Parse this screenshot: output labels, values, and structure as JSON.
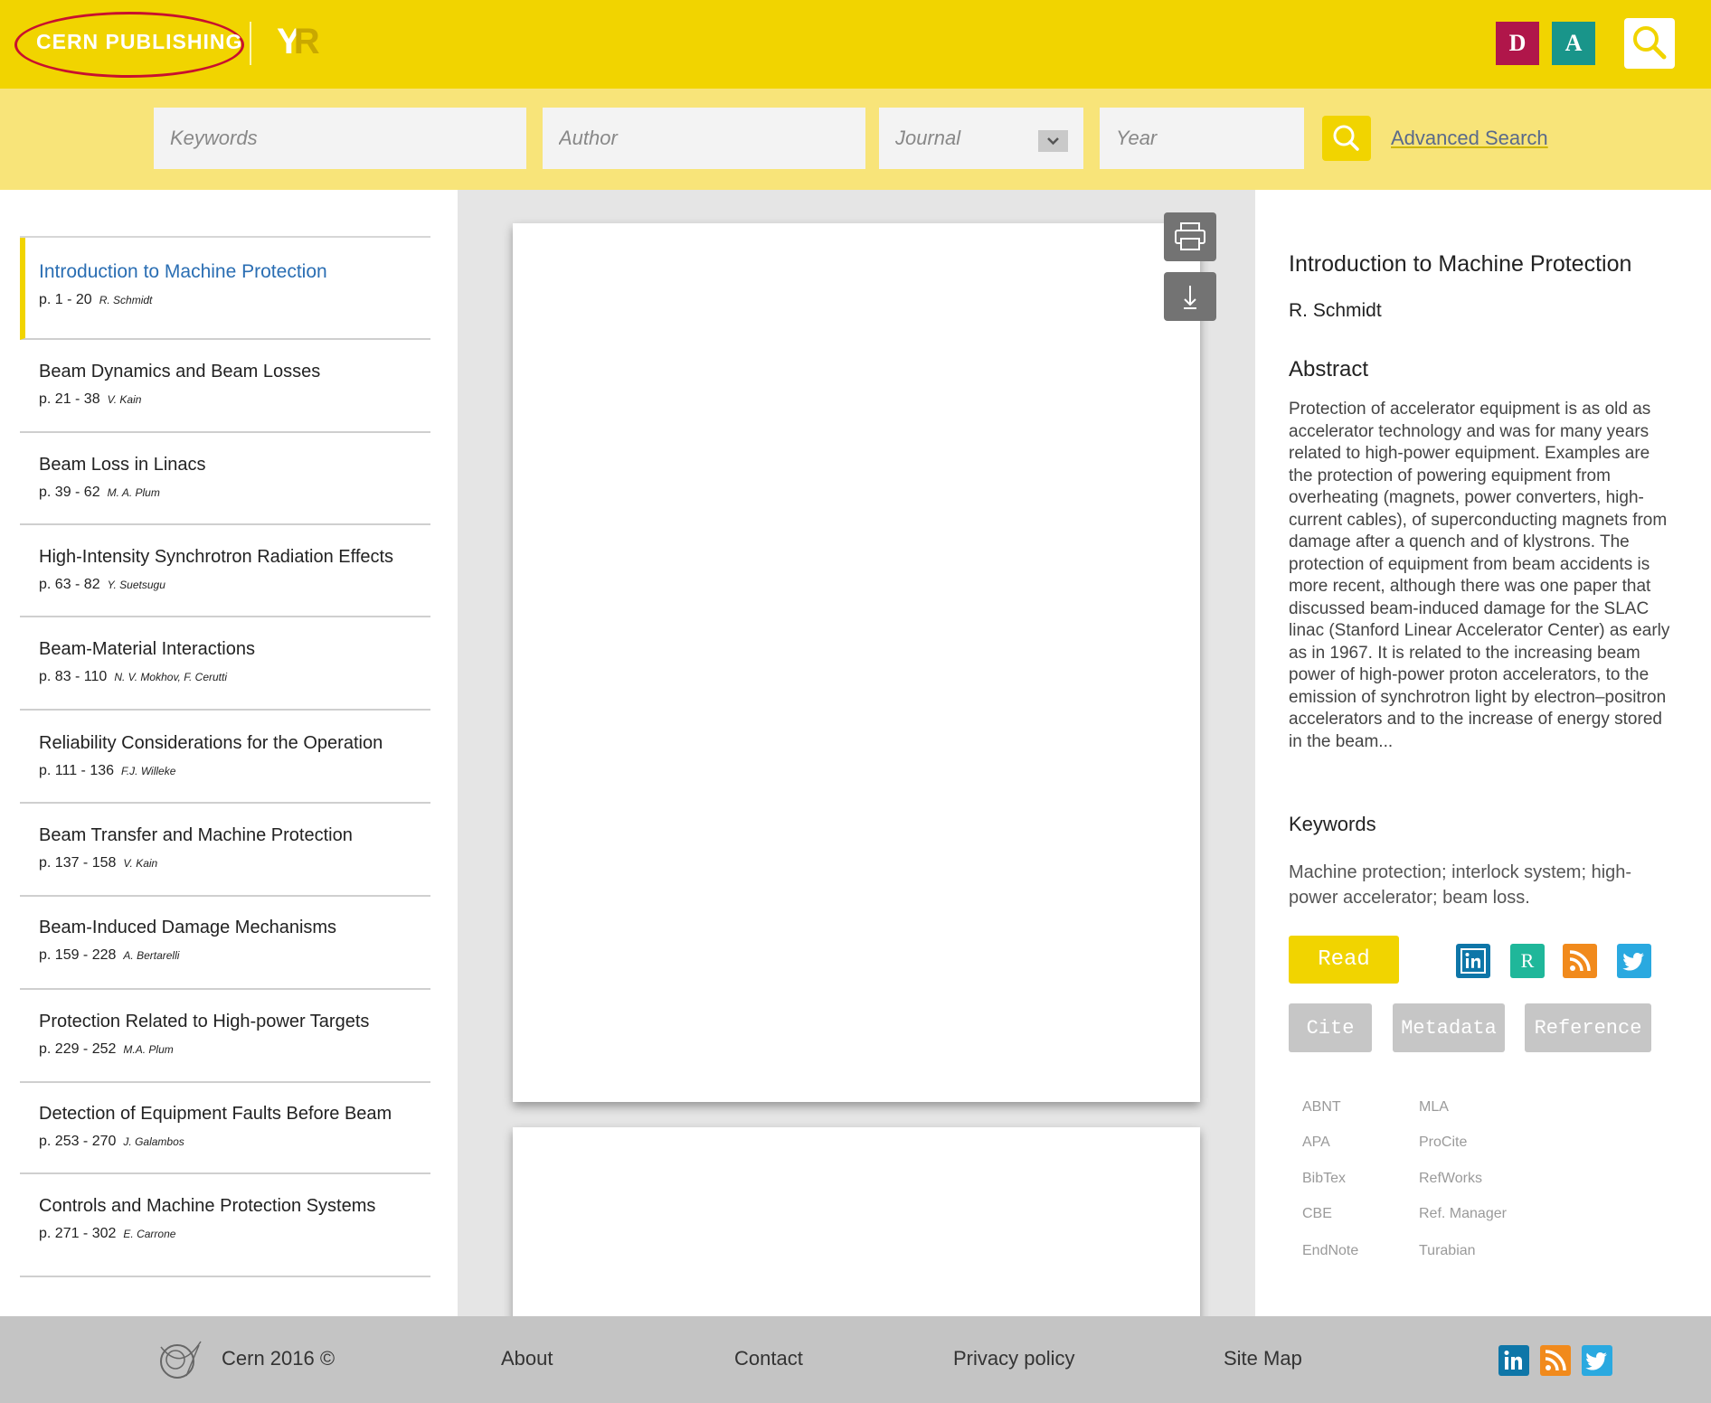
{
  "header": {
    "brand": "CERN PUBLISHING",
    "logo_text": "YR",
    "badge_d": "D",
    "badge_a": "A"
  },
  "search": {
    "keywords_placeholder": "Keywords",
    "author_placeholder": "Author",
    "journal_placeholder": "Journal",
    "year_placeholder": "Year",
    "advanced_label": "Advanced Search"
  },
  "toc": [
    {
      "title": "Introduction to Machine Protection",
      "pages": "p. 1 - 20",
      "author": "R. Schmidt"
    },
    {
      "title": "Beam Dynamics and Beam Losses",
      "pages": "p. 21 - 38",
      "author": "V. Kain"
    },
    {
      "title": "Beam Loss in Linacs",
      "pages": "p. 39 - 62",
      "author": "M. A. Plum"
    },
    {
      "title": "High-Intensity Synchrotron Radiation Effects",
      "pages": "p. 63 - 82",
      "author": "Y. Suetsugu"
    },
    {
      "title": "Beam-Material Interactions",
      "pages": "p. 83 - 110",
      "author": "N. V. Mokhov, F. Cerutti"
    },
    {
      "title": "Reliability Considerations for the Operation",
      "pages": "p. 111 - 136",
      "author": "F.J. Willeke"
    },
    {
      "title": "Beam Transfer and Machine Protection",
      "pages": "p. 137 - 158",
      "author": "V. Kain"
    },
    {
      "title": "Beam-Induced Damage Mechanisms",
      "pages": "p. 159 - 228",
      "author": "A. Bertarelli"
    },
    {
      "title": "Protection Related to High-power Targets",
      "pages": "p. 229 - 252",
      "author": "M.A. Plum"
    },
    {
      "title": "Detection of Equipment Faults Before Beam",
      "pages": "p. 253 - 270",
      "author": "J. Galambos"
    },
    {
      "title": "Controls and Machine Protection Systems",
      "pages": "p. 271 - 302",
      "author": "E. Carrone"
    }
  ],
  "detail": {
    "title": "Introduction to Machine Protection",
    "author": "R. Schmidt",
    "abstract_heading": "Abstract",
    "abstract": "Protection of accelerator equipment is as old as accelerator technology and was for many years related to high-power equipment. Examples are the protection of powering equipment from overheating (magnets, power converters, high-current cables), of superconducting magnets from damage after a quench and of klystrons. The protection of equipment from beam accidents is more recent, although there was one paper that discussed beam-induced damage for the SLAC linac (Stanford Linear Accelerator Center) as early as in 1967. It is related to the increasing beam power of high-power proton accelerators, to the emission of synchrotron light by electron–positron accelerators and to the increase of energy stored in the beam...",
    "keywords_heading": "Keywords",
    "keywords": "Machine protection; interlock system; high-power accelerator; beam loss.",
    "read_label": "Read",
    "cite_label": "Cite",
    "metadata_label": "Metadata",
    "reference_label": "Reference",
    "researchgate_glyph": "R",
    "formats_left": [
      "ABNT",
      "APA",
      "BibTex",
      "CBE",
      "EndNote"
    ],
    "formats_right": [
      "MLA",
      "ProCite",
      "RefWorks",
      "Ref. Manager",
      "Turabian"
    ]
  },
  "footer": {
    "copyright": "Cern 2016 ©",
    "about": "About",
    "contact": "Contact",
    "privacy": "Privacy policy",
    "sitemap": "Site Map"
  },
  "colors": {
    "accent_yellow": "#f1d400",
    "search_strip": "#f8e479",
    "active_link": "#2a6eb3",
    "brand_oval": "#c8102e",
    "linkedin": "#0e76a8",
    "rss": "#f18a1c",
    "twitter": "#2aa9e0",
    "researchgate": "#1fb79a"
  }
}
